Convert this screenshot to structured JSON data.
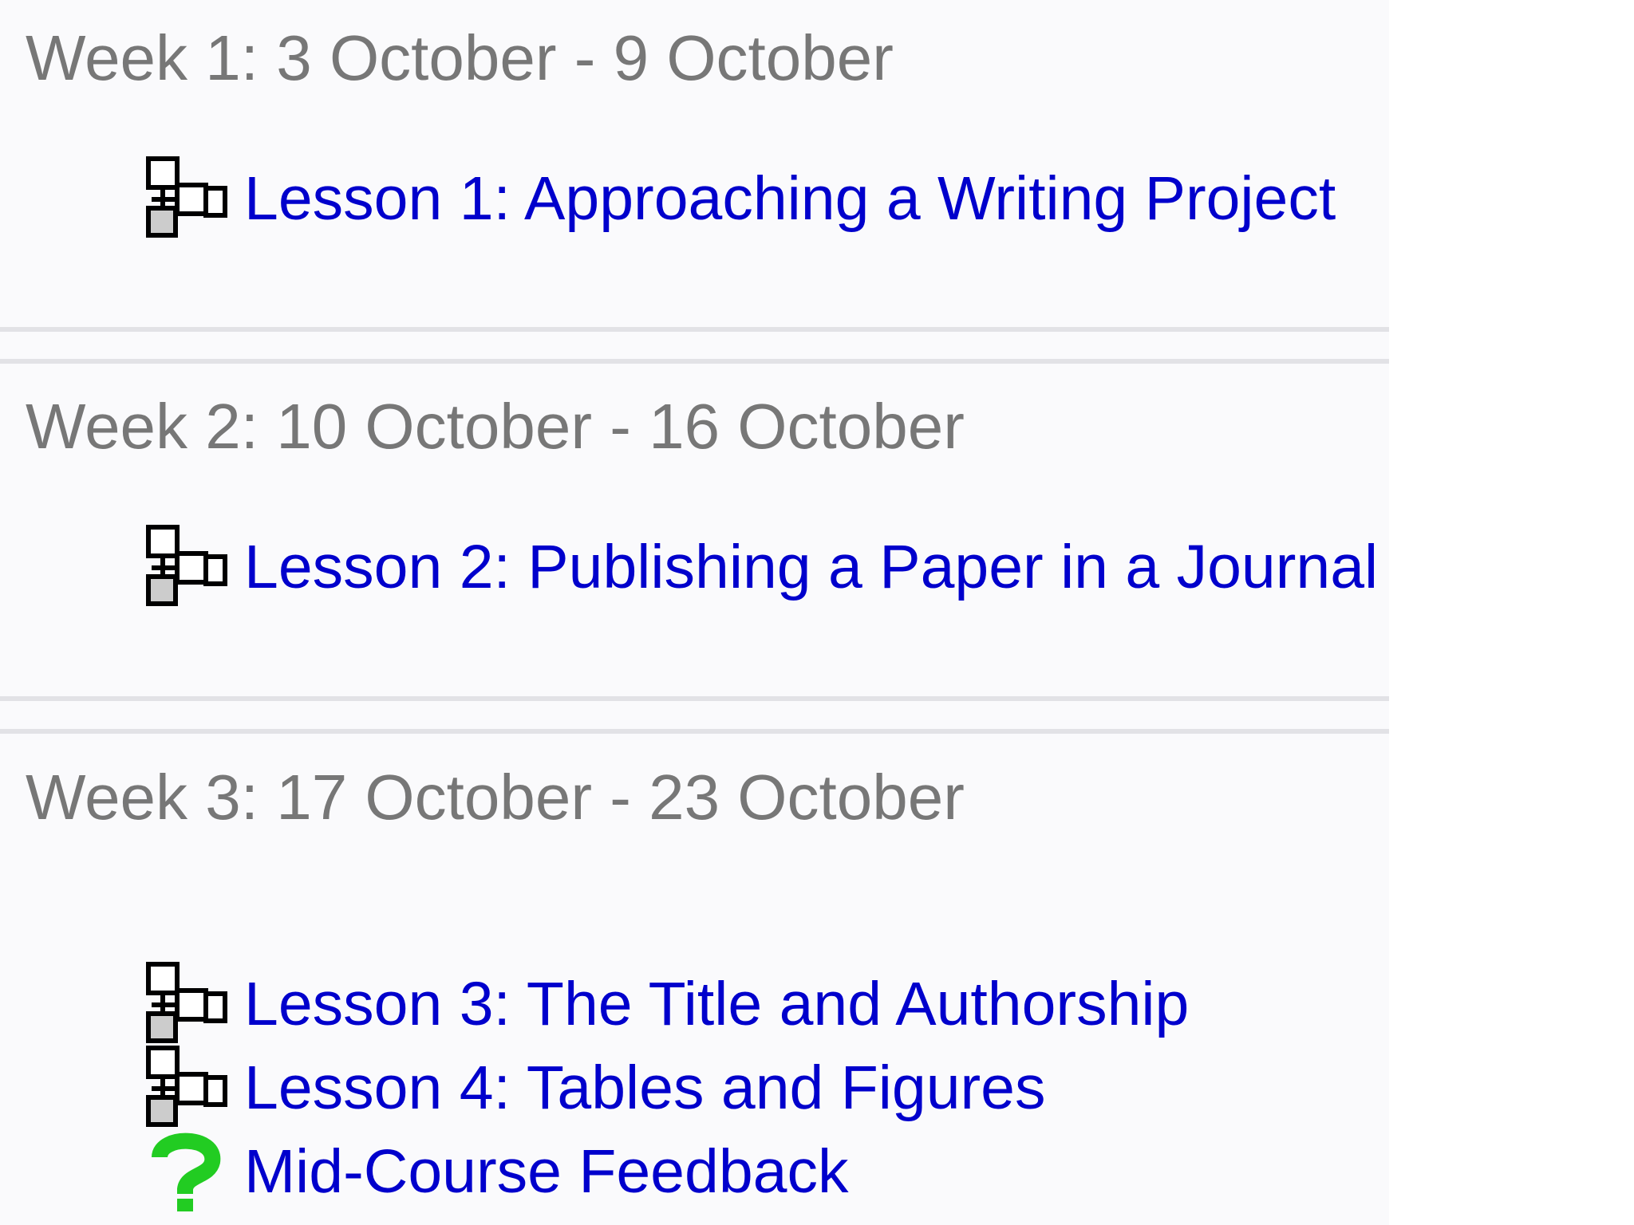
{
  "weeks": [
    {
      "title": "Week 1: 3 October - 9 October",
      "activities": [
        {
          "icon": "lesson-icon",
          "label": "Lesson 1: Approaching a Writing Project"
        }
      ]
    },
    {
      "title": "Week 2: 10 October - 16 October",
      "activities": [
        {
          "icon": "lesson-icon",
          "label": "Lesson 2: Publishing a Paper in a Journal"
        }
      ]
    },
    {
      "title": "Week 3: 17 October - 23 October",
      "activities": [
        {
          "icon": "lesson-icon",
          "label": "Lesson 3: The Title and Authorship"
        },
        {
          "icon": "lesson-icon",
          "label": "Lesson 4: Tables and Figures"
        },
        {
          "icon": "question-mark-icon",
          "label": "Mid-Course Feedback"
        }
      ]
    }
  ],
  "colors": {
    "week_title": "#777777",
    "link": "#0000cc",
    "panel_background": "#fafafc",
    "divider": "#e2e2e6",
    "feedback_icon": "#22cc22"
  }
}
